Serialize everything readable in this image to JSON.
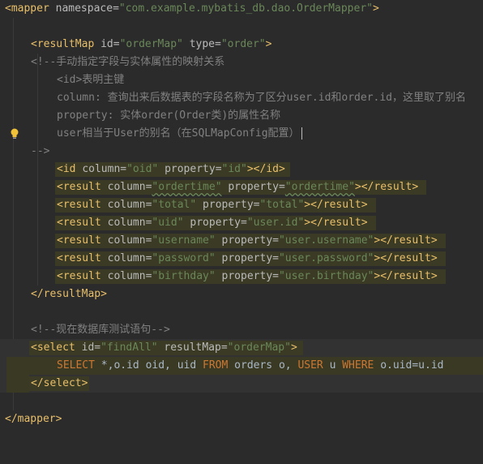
{
  "colors": {
    "background": "#2b2b2b",
    "tag": "#e8bf6a",
    "attr": "#bababa",
    "value": "#6a8759",
    "comment": "#808080",
    "sql_keyword": "#cc7832",
    "highlight": "#3b3a24"
  },
  "icons": {
    "bulb": "lightbulb-icon"
  },
  "code": {
    "l1": {
      "lt": "<",
      "tag": "mapper",
      "sp": " ",
      "attr": "namespace",
      "eq": "=",
      "val": "\"com.example.mybatis_db.dao.OrderMapper\"",
      "gt": ">"
    },
    "l3": {
      "lt": "<",
      "tag": "resultMap",
      "sp1": " ",
      "attr1": "id",
      "eq1": "=",
      "val1": "\"orderMap\"",
      "sp2": " ",
      "attr2": "type",
      "eq2": "=",
      "val2": "\"order\"",
      "gt": ">"
    },
    "l4": "<!--手动指定字段与实体属性的映射关系",
    "l5": "<id>表明主键",
    "l6": "column: 查询出来后数据表的字段名称为了区分user.id和order.id，这里取了别名",
    "l7": "property: 实体order(Order类)的属性名称",
    "l8": "user相当于User的别名（在SQLMapConfig配置）",
    "l9": "-->",
    "l10": {
      "lt": "<",
      "tag": "id",
      "a1": "column",
      "v1": "\"oid\"",
      "a2": "property",
      "v2": "\"id\"",
      "close": "></",
      "ctag": "id",
      "gt": ">"
    },
    "l11": {
      "lt": "<",
      "tag": "result",
      "a1": "column",
      "v1": "\"ordertime\"",
      "a2": "property",
      "v2": "\"ordertime\"",
      "close": "></",
      "ctag": "result",
      "gt": ">"
    },
    "l12": {
      "lt": "<",
      "tag": "result",
      "a1": "column",
      "v1": "\"total\"",
      "a2": "property",
      "v2": "\"total\"",
      "close": "></",
      "ctag": "result",
      "gt": ">"
    },
    "l13": {
      "lt": "<",
      "tag": "result",
      "a1": "column",
      "v1": "\"uid\"",
      "a2": "property",
      "v2": "\"user.id\"",
      "close": "></",
      "ctag": "result",
      "gt": ">"
    },
    "l14": {
      "lt": "<",
      "tag": "result",
      "a1": "column",
      "v1": "\"username\"",
      "a2": "property",
      "v2": "\"user.username\"",
      "close": "></",
      "ctag": "result",
      "gt": ">"
    },
    "l15": {
      "lt": "<",
      "tag": "result",
      "a1": "column",
      "v1": "\"password\"",
      "a2": "property",
      "v2": "\"user.password\"",
      "close": "></",
      "ctag": "result",
      "gt": ">"
    },
    "l16": {
      "lt": "<",
      "tag": "result",
      "a1": "column",
      "v1": "\"birthday\"",
      "a2": "property",
      "v2": "\"user.birthday\"",
      "close": "></",
      "ctag": "result",
      "gt": ">"
    },
    "l17": {
      "lt": "</",
      "tag": "resultMap",
      "gt": ">"
    },
    "l19": "<!--现在数据库测试语句-->",
    "l20": {
      "lt": "<",
      "tag": "select",
      "a1": "id",
      "v1": "\"findAll\"",
      "a2": "resultMap",
      "v2": "\"orderMap\"",
      "gt": ">"
    },
    "l21": {
      "kw1": "SELECT",
      "p1": " *,o.id oid, uid ",
      "kw2": "FROM",
      "p2": " orders o, ",
      "kw3": "USER",
      "p3": " u ",
      "kw4": "WHERE",
      "p4": " o.uid=u.id"
    },
    "l22": {
      "lt": "</",
      "tag": "select",
      "gt": ">"
    },
    "l24": {
      "lt": "</",
      "tag": "mapper",
      "gt": ">"
    }
  }
}
